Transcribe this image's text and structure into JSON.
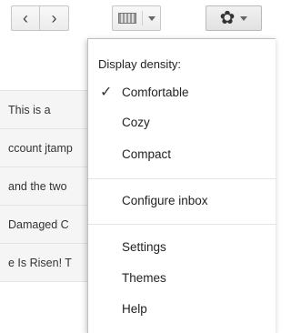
{
  "toolbar": {
    "prev_icon": "chevron-left-icon",
    "next_icon": "chevron-right-icon",
    "keyboard_icon": "keyboard-icon",
    "settings_icon": "gear-icon"
  },
  "email_snippets": [
    "This is a",
    "ccount jtamp",
    "and the two",
    "Damaged C",
    "e Is Risen! T"
  ],
  "settings_menu": {
    "header": "Display density:",
    "density_options": [
      {
        "label": "Comfortable",
        "selected": true
      },
      {
        "label": "Cozy",
        "selected": false
      },
      {
        "label": "Compact",
        "selected": false
      }
    ],
    "configure_inbox": "Configure inbox",
    "settings": "Settings",
    "themes": "Themes",
    "help": "Help"
  }
}
